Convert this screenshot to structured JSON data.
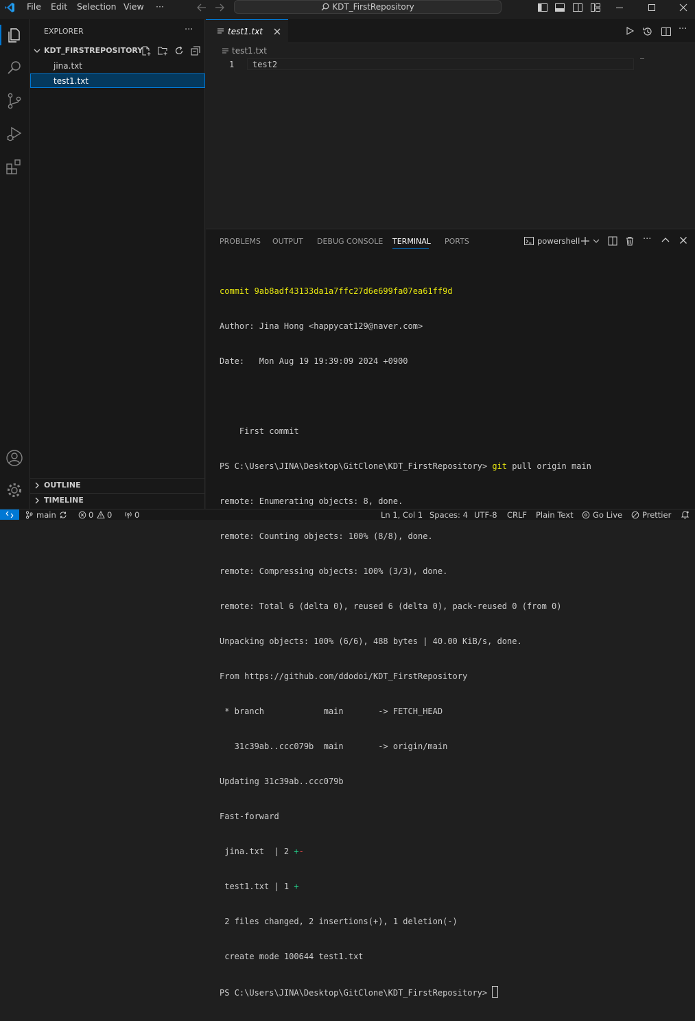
{
  "menu": {
    "file": "File",
    "edit": "Edit",
    "selection": "Selection",
    "view": "View",
    "more": "···"
  },
  "search": {
    "text": "KDT_FirstRepository"
  },
  "explorer": {
    "title": "EXPLORER",
    "more": "···",
    "folder": "KDT_FIRSTREPOSITORY",
    "files": [
      "jina.txt",
      "test1.txt"
    ],
    "selected_file": "test1.txt",
    "outline": "OUTLINE",
    "timeline": "TIMELINE"
  },
  "editor": {
    "tab_label": "test1.txt",
    "breadcrumb": "test1.txt",
    "line_number": "1",
    "line_text": "test2"
  },
  "panel": {
    "tabs": [
      "PROBLEMS",
      "OUTPUT",
      "DEBUG CONSOLE",
      "TERMINAL",
      "PORTS"
    ],
    "active_tab": "TERMINAL",
    "shell": "powershell"
  },
  "terminal": {
    "lines": [
      {
        "a": "commit 9ab8adf43133da1a7ffc27d6e699fa07ea61ff9d",
        "b": "",
        "c": "",
        "d": ""
      },
      {
        "a": "Author: Jina Hong <happycat129@naver.com>",
        "b": "",
        "c": "",
        "d": ""
      },
      {
        "a": "Date:   Mon Aug 19 19:39:09 2024 +0900",
        "b": "",
        "c": "",
        "d": ""
      },
      {
        "a": "",
        "b": "",
        "c": "",
        "d": ""
      },
      {
        "a": "    First commit",
        "b": "",
        "c": "",
        "d": ""
      },
      {
        "a": "PS C:\\Users\\JINA\\Desktop\\GitClone\\KDT_FirstRepository> ",
        "b": "git",
        "c": " pull origin main",
        "d": ""
      },
      {
        "a": "remote: Enumerating objects: 8, done.",
        "b": "",
        "c": "",
        "d": ""
      },
      {
        "a": "remote: Counting objects: 100% (8/8), done.",
        "b": "",
        "c": "",
        "d": ""
      },
      {
        "a": "remote: Compressing objects: 100% (3/3), done.",
        "b": "",
        "c": "",
        "d": ""
      },
      {
        "a": "remote: Total 6 (delta 0), reused 6 (delta 0), pack-reused 0 (from 0)",
        "b": "",
        "c": "",
        "d": ""
      },
      {
        "a": "Unpacking objects: 100% (6/6), 488 bytes | 40.00 KiB/s, done.",
        "b": "",
        "c": "",
        "d": ""
      },
      {
        "a": "From https://github.com/ddodoi/KDT_FirstRepository",
        "b": "",
        "c": "",
        "d": ""
      },
      {
        "a": " * branch            main       -> FETCH_HEAD",
        "b": "",
        "c": "",
        "d": ""
      },
      {
        "a": "   31c39ab..ccc079b  main       -> origin/main",
        "b": "",
        "c": "",
        "d": ""
      },
      {
        "a": "Updating 31c39ab..ccc079b",
        "b": "",
        "c": "",
        "d": ""
      },
      {
        "a": "Fast-forward",
        "b": "",
        "c": "",
        "d": ""
      },
      {
        "a": " jina.txt  | 2 ",
        "b": "+",
        "c": "",
        "d": "-"
      },
      {
        "a": " test1.txt | 1 ",
        "b": "+",
        "c": "",
        "d": ""
      },
      {
        "a": " 2 files changed, 2 insertions(+), 1 deletion(-)",
        "b": "",
        "c": "",
        "d": ""
      },
      {
        "a": " create mode 100644 test1.txt",
        "b": "",
        "c": "",
        "d": ""
      },
      {
        "a": "PS C:\\Users\\JINA\\Desktop\\GitClone\\KDT_FirstRepository> ",
        "b": "",
        "c": "",
        "d": ""
      }
    ]
  },
  "status": {
    "branch": "main",
    "errors": "0",
    "warnings": "0",
    "ports": "0",
    "position": "Ln 1, Col 1",
    "spaces": "Spaces: 4",
    "encoding": "UTF-8",
    "eol": "CRLF",
    "language": "Plain Text",
    "golive": "Go Live",
    "prettier": "Prettier"
  },
  "colors": {
    "accent": "#0078d4",
    "commit_hash": "#e5e510",
    "command": "#e5e510",
    "diff_add": "#23d18b",
    "diff_del": "#f14c4c",
    "remote_indicator": "#0078d4"
  }
}
